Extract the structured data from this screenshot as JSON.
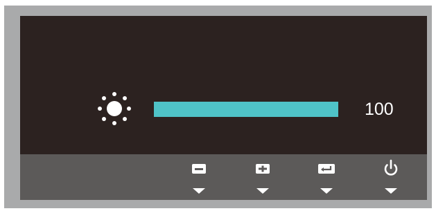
{
  "osd": {
    "setting_icon": "brightness-sun-icon",
    "value": "100",
    "level_fraction": 1.0
  },
  "buttons": [
    {
      "name": "minus-button",
      "icon": "minus-icon"
    },
    {
      "name": "plus-button",
      "icon": "plus-icon"
    },
    {
      "name": "enter-button",
      "icon": "enter-icon"
    },
    {
      "name": "power-button",
      "icon": "power-icon"
    }
  ],
  "colors": {
    "bezel": "#a9aaab",
    "screen": "#2c2220",
    "button_bar": "#5c5a59",
    "level_bar": "#4fc3c7",
    "foreground": "#ffffff"
  }
}
